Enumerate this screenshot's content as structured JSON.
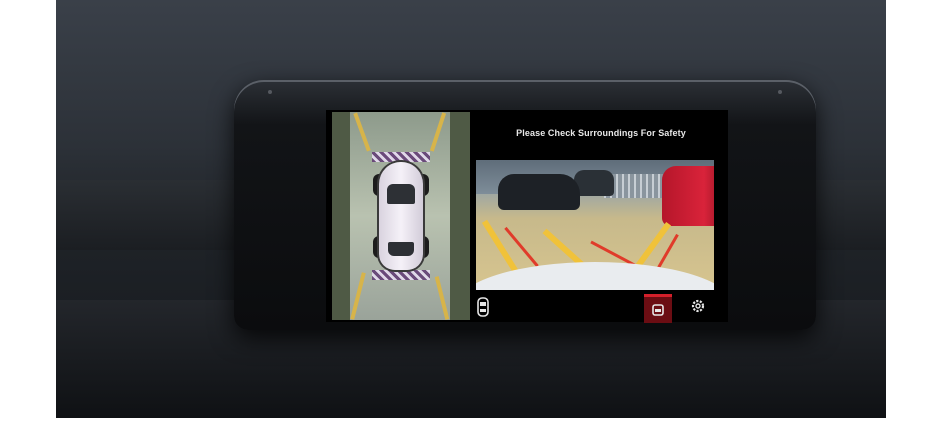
{
  "screen": {
    "title": "Please Check Surroundings For Safety"
  },
  "controls": {
    "view_switch_icon": "car-top-view-icon",
    "camera_icon": "rear-camera-icon",
    "settings_icon": "gear-icon",
    "active_accent": "#d4202b"
  }
}
